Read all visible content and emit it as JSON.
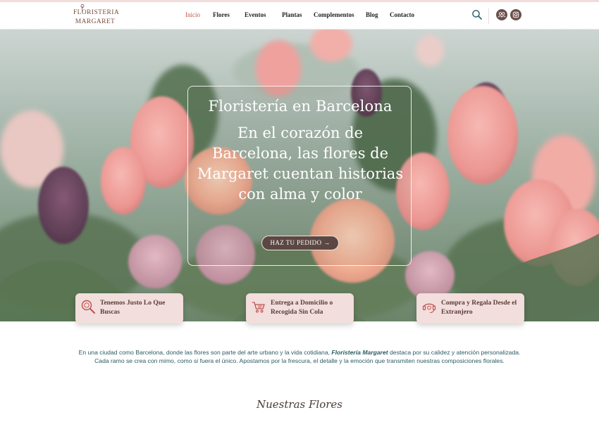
{
  "brand": {
    "line1": "FLORISTERIA",
    "line2": "MARGARET"
  },
  "nav": {
    "items": [
      {
        "label": "Inicio",
        "active": true
      },
      {
        "label": "Flores",
        "active": false
      },
      {
        "label": "Eventos",
        "active": false
      },
      {
        "label": "Plantas",
        "active": false
      },
      {
        "label": "Complementos",
        "active": false
      },
      {
        "label": "Blog",
        "active": false
      },
      {
        "label": "Contacto",
        "active": false
      }
    ]
  },
  "header_icons": [
    "search-icon",
    "people-icon",
    "instagram-icon"
  ],
  "hero": {
    "title": "Floristería en Barcelona",
    "subtitle": "En el corazón de Barcelona, las flores de Margaret cuentan historias con alma y color",
    "cta": "HAZ TU PEDIDO →"
  },
  "features": [
    {
      "icon": "magnifier-icon",
      "text": "Tenemos Justo Lo Que Buscas"
    },
    {
      "icon": "delivery-cart-icon",
      "text": "Entrega a Domicilio o Recogida Sin Cola"
    },
    {
      "icon": "gift-icon",
      "text": "Compra y Regala Desde el Extranjero"
    }
  ],
  "intro": {
    "line1_before": "En una ciudad como Barcelona, donde las flores son parte del arte urbano y la vida cotidiana,",
    "brand": "Floristería Margaret",
    "line1_after": "destaca por su calidez y atención personalizada.",
    "line2": "Cada ramo se crea con mimo, como si fuera el único. Apostamos por la frescura, el detalle y la emoción que transmiten nuestras composiciones florales."
  },
  "section": {
    "title": "Nuestras Flores"
  },
  "colors": {
    "accent": "#c0504d",
    "brand_brown": "#6b4f4a",
    "feature_bg": "#f2dedc",
    "text_teal": "#2a5b62"
  }
}
